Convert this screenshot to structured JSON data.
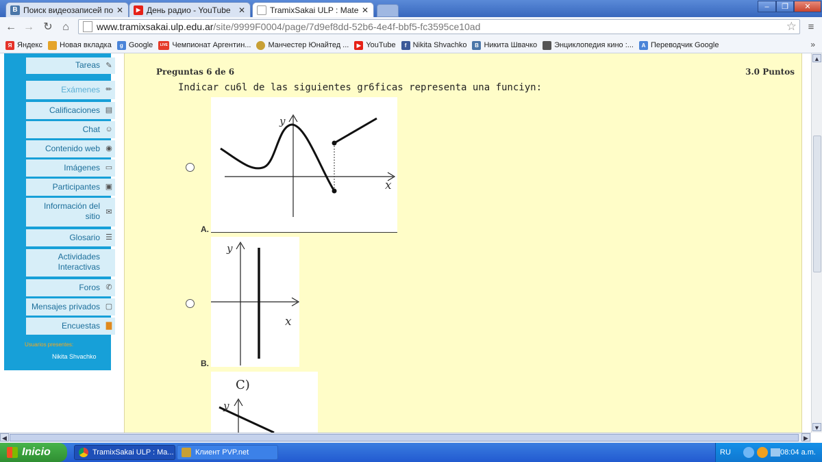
{
  "browser": {
    "tabs": [
      {
        "title": "Поиск видеозаписей по заг",
        "icon": "vk-icon",
        "icon_color": "#4a76a8",
        "active": false
      },
      {
        "title": "День радио - YouTube",
        "icon": "youtube-icon",
        "icon_color": "#e62117",
        "active": false
      },
      {
        "title": "TramixSakai ULP : Matemátic",
        "icon": "page-icon",
        "icon_color": "#ffffff",
        "active": true
      }
    ],
    "url_host": "www.tramixsakai.ulp.edu.ar",
    "url_path": "/site/9999F0004/page/7d9ef8dd-52b6-4e4f-bbf5-fc3595ce10ad",
    "bookmarks": [
      {
        "label": "Яндекс",
        "icon": "yandex-icon",
        "color": "#e5332a",
        "glyph": "Я"
      },
      {
        "label": "Новая вкладка",
        "icon": "new-tab-icon",
        "color": "#e5a42a",
        "glyph": ""
      },
      {
        "label": "Google",
        "icon": "google-icon",
        "color": "#4a84d8",
        "glyph": "g"
      },
      {
        "label": "Чемпионат Аргентин...",
        "icon": "live-icon",
        "color": "#e53b2a",
        "glyph": "LIVE"
      },
      {
        "label": "Манчестер Юнайтед ...",
        "icon": "mu-icon",
        "color": "#c8a035",
        "glyph": ""
      },
      {
        "label": "YouTube",
        "icon": "youtube-icon",
        "color": "#e62117",
        "glyph": "▶"
      },
      {
        "label": "Nikita Shvachko",
        "icon": "facebook-icon",
        "color": "#3b5998",
        "glyph": "f"
      },
      {
        "label": "Никита Швачко",
        "icon": "vk-icon",
        "color": "#4a76a8",
        "glyph": "B"
      },
      {
        "label": "Энциклопедия кино :...",
        "icon": "film-icon",
        "color": "#555555",
        "glyph": ""
      },
      {
        "label": "Переводчик Google",
        "icon": "translate-icon",
        "color": "#4a84d8",
        "glyph": "A"
      }
    ],
    "bookmarks_more": "»"
  },
  "sidebar": {
    "items": [
      {
        "label": "Tareas",
        "icon": "edit-icon",
        "glyph": "✎"
      },
      {
        "label": "Exámenes",
        "icon": "pencil-icon",
        "glyph": "✏"
      },
      {
        "label": "Calificaciones",
        "icon": "grades-icon",
        "glyph": "▤"
      },
      {
        "label": "Chat",
        "icon": "chat-icon",
        "glyph": "☺"
      },
      {
        "label": "Contenido web",
        "icon": "web-icon",
        "glyph": "◉"
      },
      {
        "label": "Imágenes",
        "icon": "monitor-icon",
        "glyph": "▭"
      },
      {
        "label": "Participantes",
        "icon": "card-icon",
        "glyph": "▣"
      },
      {
        "label": "Información del sitio",
        "icon": "info-icon",
        "glyph": "✉"
      },
      {
        "label": "Glosario",
        "icon": "list-icon",
        "glyph": "☰"
      },
      {
        "label": "Actividades Interactivas",
        "icon": "",
        "glyph": ""
      },
      {
        "label": "Foros",
        "icon": "forum-icon",
        "glyph": "✆"
      },
      {
        "label": "Mensajes privados",
        "icon": "message-icon",
        "glyph": "▢"
      },
      {
        "label": "Encuestas",
        "icon": "bar-chart-icon",
        "glyph": "▇"
      }
    ],
    "users_title": "Usuarios presentes:",
    "users": [
      "Nikita Shvachko"
    ]
  },
  "question": {
    "number_label": "Preguntas 6 de 6",
    "points_label": "3.0 Puntos",
    "text": "Indicar cu6l de las siguientes gr6ficas representa una funciyn:",
    "options": [
      {
        "letter": "A.",
        "axis_y": "y",
        "axis_x": "x"
      },
      {
        "letter": "B.",
        "axis_y": "y",
        "axis_x": "x"
      },
      {
        "letter": "",
        "label": "C)",
        "axis_y": "y"
      }
    ]
  },
  "taskbar": {
    "start_label": "Inicio",
    "tasks": [
      {
        "label": "TramixSakai ULP : Ma...",
        "icon": "chrome-icon"
      },
      {
        "label": "Клиент PVP.net",
        "icon": "lol-icon"
      }
    ],
    "lang": "RU",
    "clock": "08:04 a.m."
  },
  "colors": {
    "sidebar": "#17a0d8",
    "menu_item_bg": "#d7eef8",
    "menu_text": "#1b6e9a",
    "main_bg": "#fffdc8",
    "users_title": "#f7a81b"
  }
}
